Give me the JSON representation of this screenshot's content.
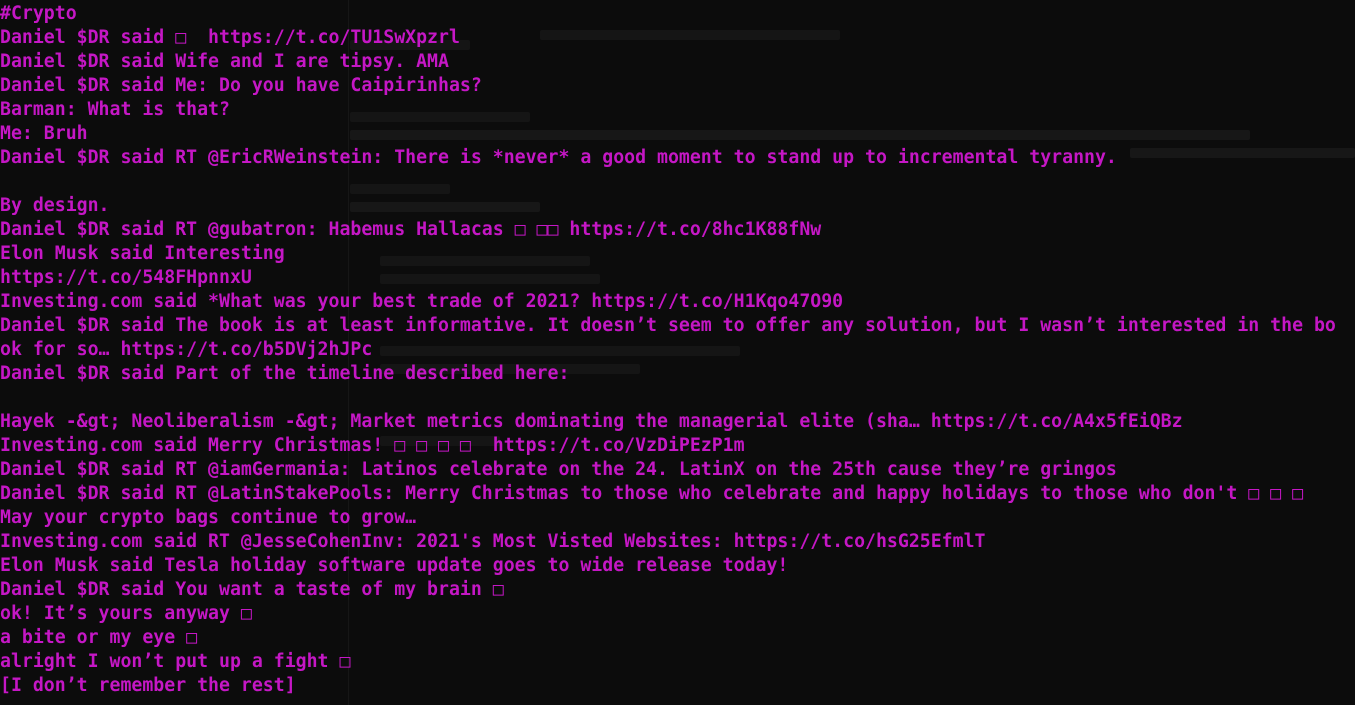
{
  "terminal": {
    "lines": [
      "#Crypto",
      "Daniel $DR said □  https://t.co/TU1SwXpzrl",
      "Daniel $DR said Wife and I are tipsy. AMA",
      "Daniel $DR said Me: Do you have Caipirinhas?",
      "Barman: What is that?",
      "Me: Bruh",
      "Daniel $DR said RT @EricRWeinstein: There is *never* a good moment to stand up to incremental tyranny.",
      "",
      "By design.",
      "Daniel $DR said RT @gubatron: Habemus Hallacas □ □□ https://t.co/8hc1K88fNw",
      "Elon Musk said Interesting",
      "https://t.co/548FHpnnxU",
      "Investing.com said *What was your best trade of 2021? https://t.co/H1Kqo47O90",
      "Daniel $DR said The book is at least informative. It doesn’t seem to offer any solution, but I wasn’t interested in the bo",
      "ok for so… https://t.co/b5DVj2hJPc",
      "Daniel $DR said Part of the timeline described here:",
      "",
      "Hayek -&gt; Neoliberalism -&gt; Market metrics dominating the managerial elite (sha… https://t.co/A4x5fEiQBz",
      "Investing.com said Merry Christmas! □ □ □ □  https://t.co/VzDiPEzP1m",
      "Daniel $DR said RT @iamGermania: Latinos celebrate on the 24. LatinX on the 25th cause they’re gringos",
      "Daniel $DR said RT @LatinStakePools: Merry Christmas to those who celebrate and happy holidays to those who don't □ □ □",
      "May your crypto bags continue to grow…",
      "Investing.com said RT @JesseCohenInv: 2021's Most Visted Websites: https://t.co/hsG25EfmlT",
      "Elon Musk said Tesla holiday software update goes to wide release today!",
      "Daniel $DR said You want a taste of my brain □",
      "ok! It’s yours anyway □",
      "a bite or my eye □",
      "alright I won’t put up a fight □",
      "[I don’t remember the rest]"
    ]
  },
  "colors": {
    "background": "#0c0c0c",
    "text": "#c517c5"
  }
}
